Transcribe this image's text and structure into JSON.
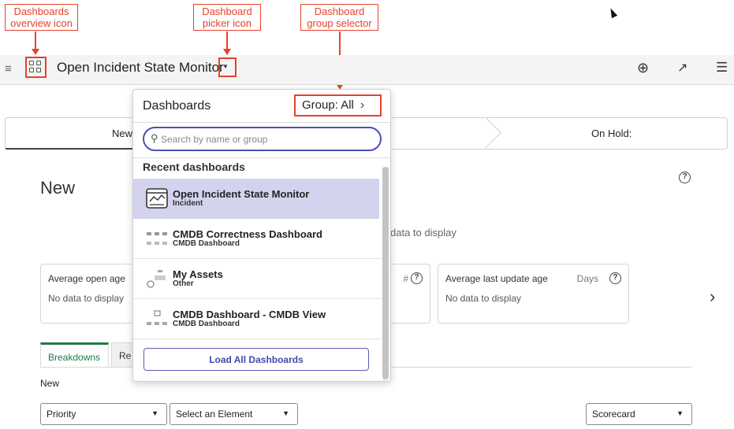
{
  "annotations": {
    "overview_icon": "Dashboards overview icon",
    "picker_icon": "Dashboard picker icon",
    "group_selector": "Dashboard group selector",
    "color": "#e8412c"
  },
  "header": {
    "title": "Open Incident State Monitor",
    "icons": [
      "menu-icon",
      "grid-icon",
      "chevron-down-icon",
      "add-circle-icon",
      "share-icon",
      "filter-settings-icon"
    ]
  },
  "stepper": {
    "steps": [
      "New",
      "On Hold:"
    ]
  },
  "section": {
    "title": "New",
    "no_data": "data to display"
  },
  "cards": [
    {
      "title": "Average open age",
      "unit": "",
      "value": "No data to display"
    },
    {
      "title": "",
      "unit": "#",
      "value": ""
    },
    {
      "title": "Average last update age",
      "unit": "Days",
      "value": "No data to display"
    }
  ],
  "tabs": [
    "Breakdowns",
    "Re"
  ],
  "breakdown_label": "New",
  "selects": {
    "first": "Priority",
    "second": "Select an Element",
    "third": "Scorecard"
  },
  "dropdown": {
    "header": "Dashboards",
    "group_label": "Group: All",
    "search_placeholder": "Search by name or group",
    "recent_label": "Recent dashboards",
    "items": [
      {
        "name": "Open Incident State Monitor",
        "group": "Incident",
        "icon": "dashboard-thumb-icon"
      },
      {
        "name": "CMDB Correctness Dashboard",
        "group": "CMDB Dashboard",
        "icon": "dashboard-thumb-icon"
      },
      {
        "name": "My Assets",
        "group": "Other",
        "icon": "dashboard-thumb-icon"
      },
      {
        "name": "CMDB Dashboard - CMDB View",
        "group": "CMDB Dashboard",
        "icon": "dashboard-thumb-icon"
      }
    ],
    "load_all": "Load All Dashboards",
    "selected_bg": "#d3d3ee",
    "accent": "#4d4fb8"
  }
}
